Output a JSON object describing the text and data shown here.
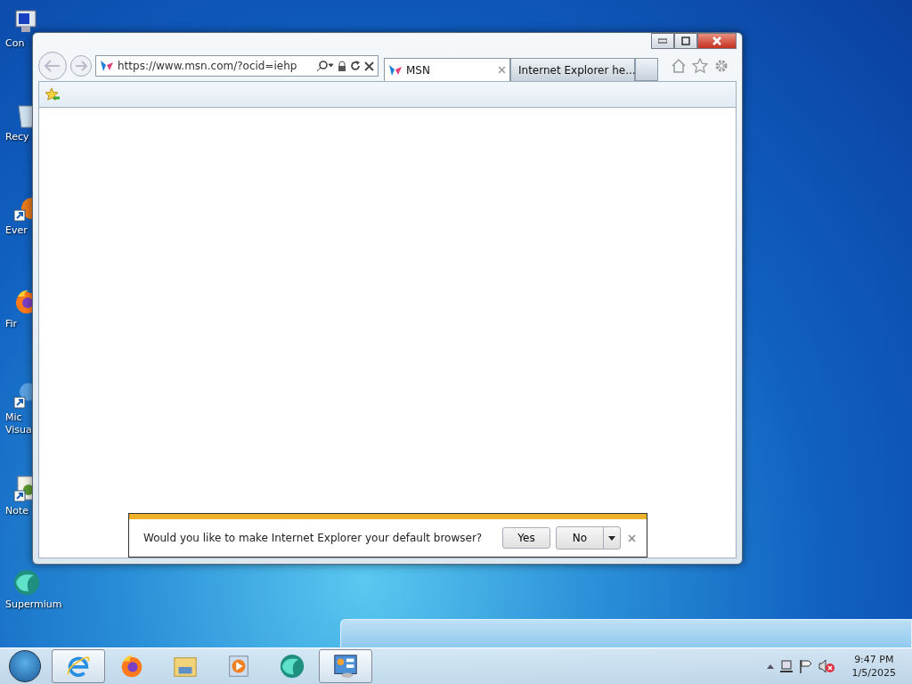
{
  "desktop_icons": [
    {
      "kind": "computer",
      "label": "Con"
    },
    {
      "kind": "recycle",
      "label": "Recy"
    },
    {
      "kind": "orange",
      "label": "Ever"
    },
    {
      "kind": "firefox",
      "label": "Fir"
    },
    {
      "kind": "globe",
      "label": "Mic\nVisua"
    },
    {
      "kind": "notepad",
      "label": "Note"
    },
    {
      "kind": "supermium",
      "label": "Supermium"
    }
  ],
  "browser": {
    "address": "https://www.msn.com/?ocid=iehp",
    "tabs": [
      {
        "label": "MSN",
        "selected": true
      },
      {
        "label": "Internet Explorer he...",
        "selected": false
      }
    ],
    "notification": {
      "message": "Would you like to make Internet Explorer your default browser?",
      "buttons": [
        "Yes",
        "No"
      ]
    }
  },
  "taskbar": {
    "apps": [
      {
        "kind": "ie",
        "running": true
      },
      {
        "kind": "firefox",
        "running": false
      },
      {
        "kind": "folder",
        "running": false
      },
      {
        "kind": "media",
        "running": false
      },
      {
        "kind": "supermium",
        "running": false
      },
      {
        "kind": "control_panel",
        "running": true
      }
    ],
    "clock": {
      "time": "9:47 PM",
      "date": "1/5/2025"
    }
  }
}
